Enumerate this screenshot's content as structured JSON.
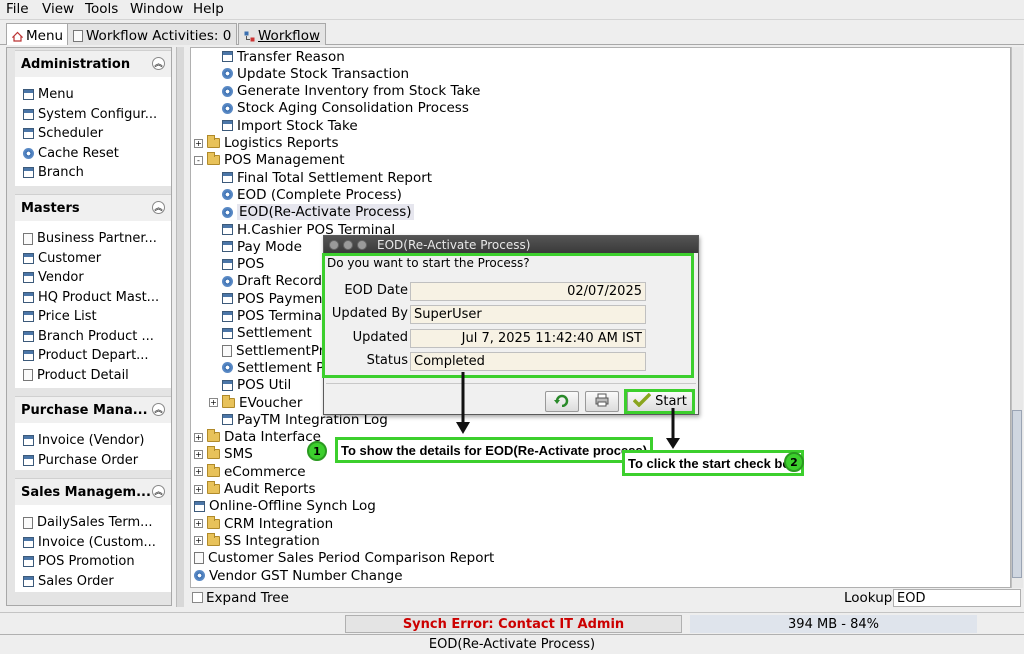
{
  "menubar": {
    "items": [
      "File",
      "View",
      "Tools",
      "Window",
      "Help"
    ]
  },
  "tabs": [
    {
      "label": "Menu",
      "icon": "home-icon"
    },
    {
      "label": "Workflow Activities: 0",
      "icon": "document-icon"
    },
    {
      "label": "Workflow",
      "icon": "workflow-icon"
    }
  ],
  "sidebar": {
    "groups": [
      {
        "title": "Administration",
        "items": [
          {
            "label": "Menu",
            "icon": "window-icon"
          },
          {
            "label": "System Configur...",
            "icon": "window-icon"
          },
          {
            "label": "Scheduler",
            "icon": "window-icon"
          },
          {
            "label": "Cache Reset",
            "icon": "gear-icon"
          },
          {
            "label": "Branch",
            "icon": "window-icon"
          }
        ]
      },
      {
        "title": "Masters",
        "items": [
          {
            "label": "Business Partner...",
            "icon": "document-icon"
          },
          {
            "label": "Customer",
            "icon": "window-icon"
          },
          {
            "label": "Vendor",
            "icon": "window-icon"
          },
          {
            "label": "HQ Product Mast...",
            "icon": "window-icon"
          },
          {
            "label": "Price List",
            "icon": "window-icon"
          },
          {
            "label": "Branch Product ...",
            "icon": "window-icon"
          },
          {
            "label": "Product Depart...",
            "icon": "window-icon"
          },
          {
            "label": "Product Detail",
            "icon": "document-icon"
          }
        ]
      },
      {
        "title": "Purchase Mana...",
        "items": [
          {
            "label": "Invoice (Vendor)",
            "icon": "window-icon"
          },
          {
            "label": "Purchase Order",
            "icon": "window-icon"
          }
        ]
      },
      {
        "title": "Sales Managem...",
        "items": [
          {
            "label": "DailySales Term...",
            "icon": "document-icon"
          },
          {
            "label": "Invoice (Custom...",
            "icon": "window-icon"
          },
          {
            "label": "POS Promotion",
            "icon": "window-icon"
          },
          {
            "label": "Sales Order",
            "icon": "window-icon"
          }
        ]
      }
    ]
  },
  "tree": {
    "rows": [
      {
        "label": "Transfer Reason",
        "icon": "window-icon",
        "level": 2
      },
      {
        "label": "Update Stock Transaction",
        "icon": "gear-icon",
        "level": 2
      },
      {
        "label": "Generate Inventory from Stock Take",
        "icon": "gear-icon",
        "level": 2
      },
      {
        "label": "Stock Aging Consolidation Process",
        "icon": "gear-icon",
        "level": 2
      },
      {
        "label": "Import Stock Take",
        "icon": "window-icon",
        "level": 2
      },
      {
        "label": "Logistics Reports",
        "icon": "folder-icon",
        "level": 1,
        "expander": "+"
      },
      {
        "label": "POS Management",
        "icon": "folder-icon",
        "level": 1,
        "expander": "-"
      },
      {
        "label": "Final Total Settlement Report",
        "icon": "window-icon",
        "level": 2
      },
      {
        "label": "EOD (Complete Process)",
        "icon": "gear-icon",
        "level": 2
      },
      {
        "label": "EOD(Re-Activate Process)",
        "icon": "gear-icon",
        "level": 2,
        "selected": true
      },
      {
        "label": "H.Cashier POS Terminal",
        "icon": "window-icon",
        "level": 2
      },
      {
        "label": "Pay Mode",
        "icon": "window-icon",
        "level": 2
      },
      {
        "label": "POS",
        "icon": "window-icon",
        "level": 2
      },
      {
        "label": "Draft Records",
        "icon": "gear-icon",
        "level": 2
      },
      {
        "label": "POS Payment",
        "icon": "window-icon",
        "level": 2
      },
      {
        "label": "POS Terminal",
        "icon": "window-icon",
        "level": 2
      },
      {
        "label": "Settlement",
        "icon": "window-icon",
        "level": 2
      },
      {
        "label": "SettlementPr",
        "icon": "document-icon",
        "level": 2
      },
      {
        "label": "Settlement P",
        "icon": "gear-icon",
        "level": 2
      },
      {
        "label": "POS Util",
        "icon": "window-icon",
        "level": 2
      },
      {
        "label": "EVoucher",
        "icon": "folder-icon",
        "level": 2,
        "expander": "+"
      },
      {
        "label": "PayTM Integration Log",
        "icon": "window-icon",
        "level": 2
      },
      {
        "label": "Data Interface",
        "icon": "folder-icon",
        "level": 1,
        "expander": "+"
      },
      {
        "label": "SMS",
        "icon": "folder-icon",
        "level": 1,
        "expander": "+"
      },
      {
        "label": "eCommerce",
        "icon": "folder-icon",
        "level": 1,
        "expander": "+"
      },
      {
        "label": "Audit Reports",
        "icon": "folder-icon",
        "level": 1,
        "expander": "+"
      },
      {
        "label": "Online-Offline Synch Log",
        "icon": "window-icon",
        "level": 1
      },
      {
        "label": "CRM Integration",
        "icon": "folder-icon",
        "level": 1,
        "expander": "+"
      },
      {
        "label": "SS Integration",
        "icon": "folder-icon",
        "level": 1,
        "expander": "+"
      },
      {
        "label": "Customer Sales Period Comparison Report",
        "icon": "document-icon",
        "level": 1
      },
      {
        "label": "Vendor GST Number Change",
        "icon": "gear-icon",
        "level": 1
      }
    ]
  },
  "bottom": {
    "expand_tree": "Expand Tree",
    "lookup_label": "Lookup",
    "lookup_value": "EOD"
  },
  "status": {
    "sync_error": "Synch Error: Contact IT Admin",
    "memory": "394 MB - 84%",
    "current": "EOD(Re-Activate Process)"
  },
  "dialog": {
    "title": "EOD(Re-Activate Process)",
    "question": "Do you want to start the Process?",
    "fields": [
      {
        "label": "EOD Date",
        "value": "02/07/2025",
        "align": "right"
      },
      {
        "label": "Updated By",
        "value": "SuperUser",
        "align": "left"
      },
      {
        "label": "Updated",
        "value": "Jul 7, 2025 11:42:40 AM IST",
        "align": "right"
      },
      {
        "label": "Status",
        "value": "Completed",
        "align": "left"
      }
    ],
    "start_label": "Start"
  },
  "annotations": [
    {
      "number": "1",
      "text": "To show the details for EOD(Re-Activate process)"
    },
    {
      "number": "2",
      "text": "To click the start check box"
    }
  ],
  "colors": {
    "highlight": "#3ccf2d",
    "error_text": "#cc0000"
  }
}
